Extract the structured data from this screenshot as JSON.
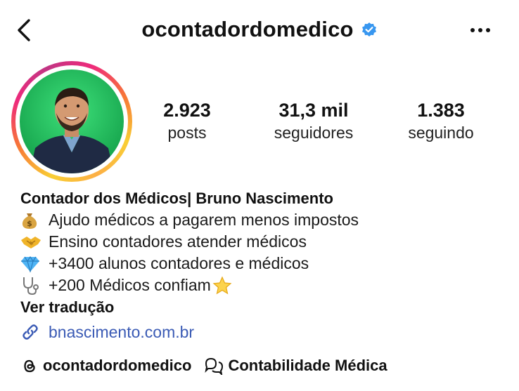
{
  "header": {
    "username": "ocontadordomedico",
    "verified_icon": "verified-badge-icon",
    "back_icon": "chevron-left-icon",
    "more_icon": "more-horizontal-icon"
  },
  "colors": {
    "verified_blue": "#3897f0",
    "link_blue": "#3b5bb5",
    "avatar_bg": "#22c55e"
  },
  "stats": [
    {
      "value": "2.923",
      "label": "posts"
    },
    {
      "value": "31,3 mil",
      "label": "seguidores"
    },
    {
      "value": "1.383",
      "label": "seguindo"
    }
  ],
  "bio": {
    "name": "Contador dos Médicos| Bruno Nascimento",
    "lines": [
      {
        "icon": "money-bag-icon",
        "text": "Ajudo médicos a pagarem menos impostos"
      },
      {
        "icon": "handshake-icon",
        "text": "Ensino contadores atender médicos"
      },
      {
        "icon": "gem-icon",
        "text": "+3400 alunos contadores e médicos"
      },
      {
        "icon": "stethoscope-icon",
        "text": "+200 Médicos confiam"
      }
    ],
    "star_icon": "star-icon",
    "translate": "Ver tradução",
    "link_icon": "link-icon",
    "link": "bnascimento.com.br"
  },
  "bottom": {
    "threads_icon": "threads-icon",
    "threads_handle": "ocontadordomedico",
    "category_icon": "chat-bubbles-icon",
    "category": "Contabilidade Médica"
  }
}
